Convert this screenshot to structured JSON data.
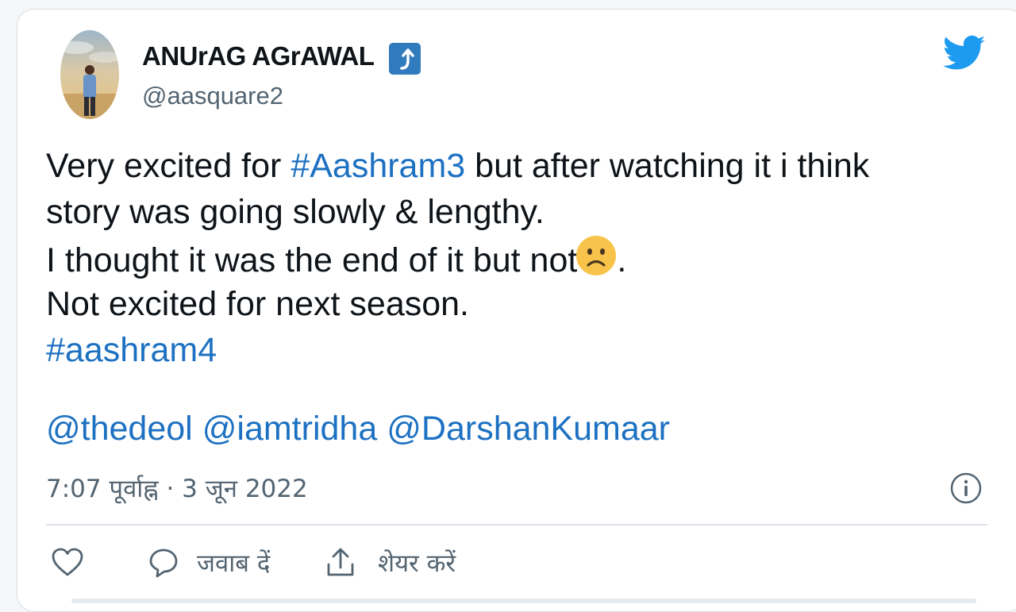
{
  "user": {
    "display_name": "ANUrAG AGrAWAL",
    "handle": "@aasquare2",
    "badge_icon": "arrow-badge-icon"
  },
  "tweet": {
    "line1_prefix": "Very excited for ",
    "line1_tag": "#Aashram3",
    "line1_suffix": " but after watching it i think",
    "line2": "story was going slowly & lengthy.",
    "line3_prefix": "I thought it was the end of it but not",
    "line3_suffix": ".",
    "line4": "Not excited for next season.",
    "line5_tag": "#aashram4",
    "mentions": [
      "@thedeol",
      "@iamtridha",
      "@DarshanKumaar"
    ]
  },
  "timestamp": "7:07 पूर्वाह्न · 3 जून 2022",
  "actions": {
    "reply_label": "जवाब दें",
    "share_label": "शेयर करें"
  },
  "colors": {
    "link": "#1d71c2",
    "twitter_blue": "#1d9bf0",
    "badge": "#2f7bbd",
    "muted": "#536471"
  }
}
